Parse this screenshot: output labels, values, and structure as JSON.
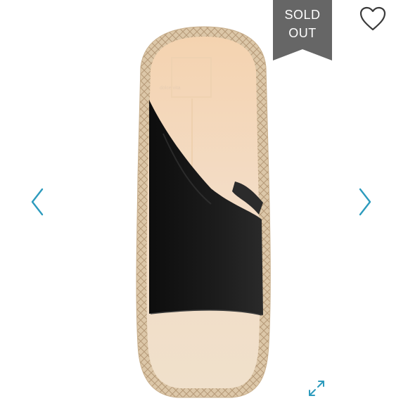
{
  "listing": {
    "status_badge": {
      "line1": "SOLD",
      "line2": "OUT",
      "color": "#666666"
    },
    "brand_label": "dolce vita",
    "controls": {
      "like": {
        "icon": "heart-outline-icon"
      },
      "previous": {
        "icon": "chevron-left-icon"
      },
      "next": {
        "icon": "chevron-right-icon"
      },
      "fullscreen": {
        "icon": "expand-arrows-icon"
      }
    },
    "colors": {
      "accent": "#2d9bbd",
      "upper_leather": "#141414",
      "footbed": "#f2dcc3",
      "rope_sole": "#d8c3a4"
    }
  }
}
